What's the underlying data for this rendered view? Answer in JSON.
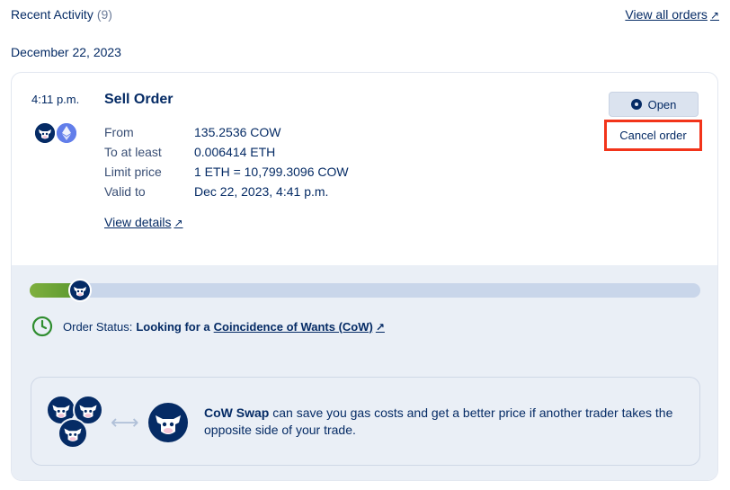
{
  "header": {
    "title": "Recent Activity",
    "count": "(9)",
    "view_all": "View all orders",
    "arrow": "↗"
  },
  "date_group": "December 22, 2023",
  "order": {
    "time": "4:11 p.m.",
    "type": "Sell Order",
    "sell_token_icon": "cow-token-icon",
    "buy_token_icon": "eth-token-icon",
    "rows": [
      {
        "label": "From",
        "value": "135.2536 COW"
      },
      {
        "label": "To at least",
        "value": "0.006414 ETH"
      },
      {
        "label": "Limit price",
        "value": "1 ETH = 10,799.3096 COW"
      },
      {
        "label": "Valid to",
        "value": "Dec 22, 2023, 4:41 p.m."
      }
    ],
    "view_details": "View details",
    "status": "Open",
    "cancel": "Cancel order",
    "progress_fraction": 0.05
  },
  "order_status": {
    "label": "Order Status:",
    "value": "Looking for a",
    "link": "Coincidence of Wants (CoW)"
  },
  "cow_info": {
    "brand": "CoW Swap",
    "text": " can save you gas costs and get a better price if another trader takes the opposite side of your trade."
  },
  "colors": {
    "navy": "#052b65",
    "highlight": "#f2341a",
    "progress_green": "#6aa436",
    "status_green": "#2f8d2f"
  }
}
